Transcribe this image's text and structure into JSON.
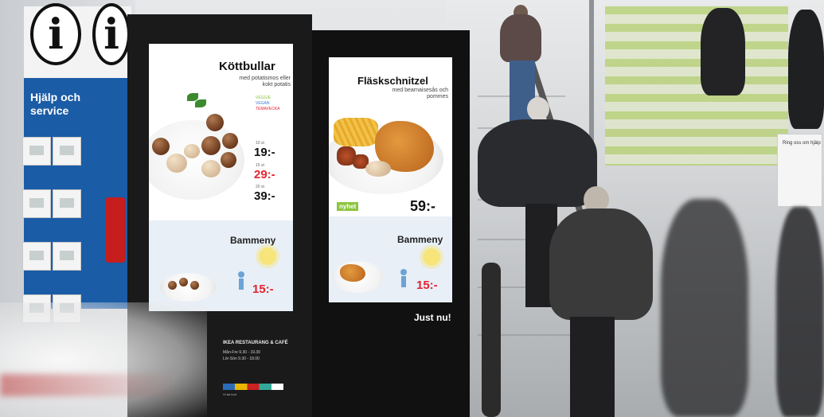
{
  "info_sign": {
    "glyph_left": "i",
    "glyph_right": "i",
    "help_text": "Hjälp och service"
  },
  "left_screen": {
    "title": "Köttbullar",
    "subtitle": "med potatismos eller kokt potatis",
    "tags": [
      "VEGGIE",
      "VEGAN",
      "TEMAVECKA"
    ],
    "prices": [
      {
        "label": "10 st",
        "value": "19:-",
        "color": "#111111"
      },
      {
        "label": "15 st",
        "value": "29:-",
        "color": "#e52230"
      },
      {
        "label": "20 st",
        "value": "39:-",
        "color": "#111111"
      }
    ],
    "kids_menu_label": "Bammeny",
    "kids_price": "15:-"
  },
  "right_screen": {
    "title": "Fläskschnitzel",
    "subtitle": "med bearnaisesås och pommes",
    "badge": "nyhet",
    "price": "59:-",
    "kids_menu_label": "Bammeny",
    "kids_price": "15:-"
  },
  "kiosk": {
    "slogan": "Just nu!",
    "hours_title": "IKEA RESTAURANG & CAFÉ",
    "hours": [
      "Mån-Fre  9.30 - 19.30",
      "Lör-Sön  9.30 - 18.00"
    ],
    "card_caption": "Vi tar kort"
  },
  "wall_sign": {
    "text": "Ring oss om hjälp"
  },
  "colors": {
    "brand_blue": "#1b5ca6",
    "price_red": "#e52230",
    "badge_green": "#8cc43f"
  }
}
